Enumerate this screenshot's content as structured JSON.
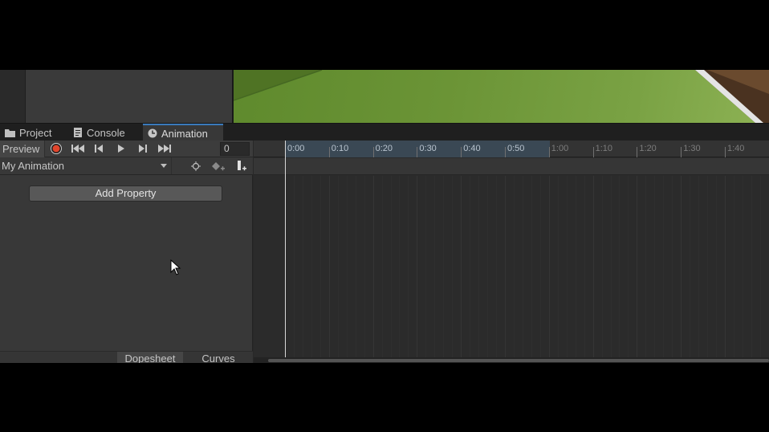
{
  "tabs": [
    {
      "label": "Project",
      "icon": "folder-icon",
      "active": false
    },
    {
      "label": "Console",
      "icon": "console-icon",
      "active": false
    },
    {
      "label": "Animation",
      "icon": "clock-icon",
      "active": true
    }
  ],
  "toolbar": {
    "preview_label": "Preview",
    "record_color": "#e0452c",
    "frame_value": "0",
    "controls": [
      "record-icon",
      "first-keyframe-icon",
      "prev-keyframe-icon",
      "play-icon",
      "next-keyframe-icon",
      "last-keyframe-icon"
    ]
  },
  "clip": {
    "selected": "My Animation",
    "icons": [
      "filter-icon",
      "add-keyframe-icon",
      "add-event-icon"
    ]
  },
  "add_property_label": "Add Property",
  "view_modes": [
    "Dopesheet",
    "Curves"
  ],
  "timeline": {
    "labels": [
      "0:00",
      "0:10",
      "0:20",
      "0:30",
      "0:40",
      "0:50",
      "1:00",
      "1:10",
      "1:20",
      "1:30",
      "1:40"
    ],
    "active_end_label": "0:50"
  },
  "colors": {
    "accent": "#3a79bb",
    "scene_ground": "#6b9436"
  }
}
